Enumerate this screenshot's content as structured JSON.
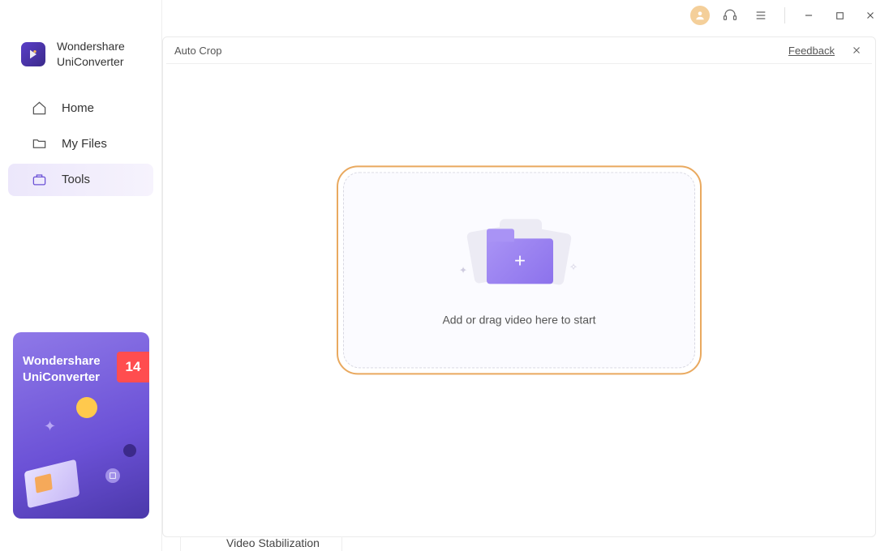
{
  "brand": {
    "name_line1": "Wondershare",
    "name_line2": "UniConverter"
  },
  "nav": {
    "home": {
      "label": "Home"
    },
    "myfiles": {
      "label": "My Files"
    },
    "tools": {
      "label": "Tools"
    }
  },
  "promo": {
    "title_line1": "Wondershare",
    "title_line2": "UniConverter",
    "badge": "14"
  },
  "panel": {
    "title": "Auto Crop",
    "feedback_label": "Feedback",
    "drop_text": "Add or drag video here to start"
  },
  "peek_tool_label": "Video Stabilization"
}
